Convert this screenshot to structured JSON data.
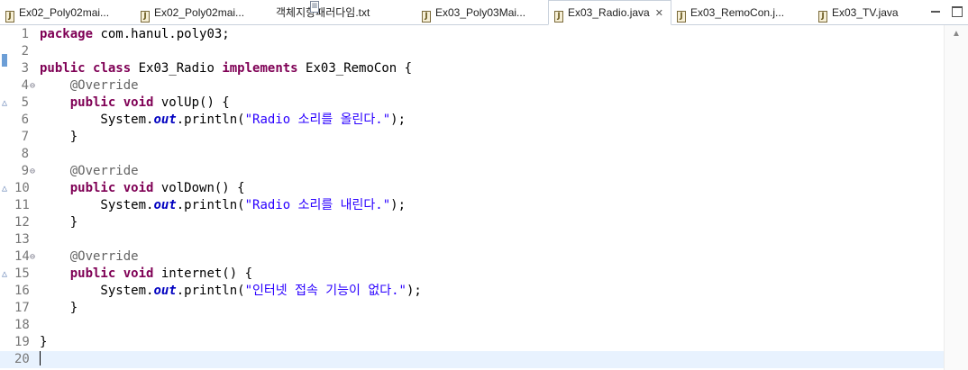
{
  "tabs": [
    {
      "label": "Ex02_Poly02mai...",
      "icon": "java-file-icon",
      "active": false
    },
    {
      "label": "Ex02_Poly02mai...",
      "icon": "java-file-icon",
      "active": false
    },
    {
      "label": "객체지향패러다임.txt",
      "icon": "text-file-icon",
      "active": false
    },
    {
      "label": "Ex03_Poly03Mai...",
      "icon": "java-file-icon",
      "active": false
    },
    {
      "label": "Ex03_Radio.java",
      "icon": "java-file-icon",
      "active": true
    },
    {
      "label": "Ex03_RemoCon.j...",
      "icon": "java-file-icon",
      "active": false
    },
    {
      "label": "Ex03_TV.java",
      "icon": "java-file-icon",
      "active": false
    }
  ],
  "editor": {
    "current_line": 20,
    "lines": [
      {
        "n": "1",
        "code": [
          [
            "kw",
            "package"
          ],
          [
            "t",
            " com.hanul.poly03;"
          ]
        ]
      },
      {
        "n": "2",
        "code": []
      },
      {
        "n": "3",
        "code": [
          [
            "kw",
            "public"
          ],
          [
            "t",
            " "
          ],
          [
            "kw",
            "class"
          ],
          [
            "t",
            " Ex03_Radio "
          ],
          [
            "kw",
            "implements"
          ],
          [
            "t",
            " Ex03_RemoCon {"
          ]
        ]
      },
      {
        "n": "4",
        "fold": true,
        "code": [
          [
            "t",
            "    "
          ],
          [
            "ann",
            "@Override"
          ]
        ]
      },
      {
        "n": "5",
        "override": true,
        "code": [
          [
            "t",
            "    "
          ],
          [
            "kw",
            "public"
          ],
          [
            "t",
            " "
          ],
          [
            "kw",
            "void"
          ],
          [
            "t",
            " volUp() {"
          ]
        ]
      },
      {
        "n": "6",
        "code": [
          [
            "t",
            "        System."
          ],
          [
            "fld",
            "out"
          ],
          [
            "t",
            ".println("
          ],
          [
            "str",
            "\"Radio 소리를 올린다.\""
          ],
          [
            "t",
            ");"
          ]
        ]
      },
      {
        "n": "7",
        "code": [
          [
            "t",
            "    }"
          ]
        ]
      },
      {
        "n": "8",
        "code": []
      },
      {
        "n": "9",
        "fold": true,
        "code": [
          [
            "t",
            "    "
          ],
          [
            "ann",
            "@Override"
          ]
        ]
      },
      {
        "n": "10",
        "override": true,
        "code": [
          [
            "t",
            "    "
          ],
          [
            "kw",
            "public"
          ],
          [
            "t",
            " "
          ],
          [
            "kw",
            "void"
          ],
          [
            "t",
            " volDown() {"
          ]
        ]
      },
      {
        "n": "11",
        "code": [
          [
            "t",
            "        System."
          ],
          [
            "fld",
            "out"
          ],
          [
            "t",
            ".println("
          ],
          [
            "str",
            "\"Radio 소리를 내린다.\""
          ],
          [
            "t",
            ");"
          ]
        ]
      },
      {
        "n": "12",
        "code": [
          [
            "t",
            "    }"
          ]
        ]
      },
      {
        "n": "13",
        "code": []
      },
      {
        "n": "14",
        "fold": true,
        "code": [
          [
            "t",
            "    "
          ],
          [
            "ann",
            "@Override"
          ]
        ]
      },
      {
        "n": "15",
        "override": true,
        "code": [
          [
            "t",
            "    "
          ],
          [
            "kw",
            "public"
          ],
          [
            "t",
            " "
          ],
          [
            "kw",
            "void"
          ],
          [
            "t",
            " internet() {"
          ]
        ]
      },
      {
        "n": "16",
        "code": [
          [
            "t",
            "        System."
          ],
          [
            "fld",
            "out"
          ],
          [
            "t",
            ".println("
          ],
          [
            "str",
            "\"인터넷 접속 기능이 없다.\""
          ],
          [
            "t",
            ");"
          ]
        ]
      },
      {
        "n": "17",
        "code": [
          [
            "t",
            "    }"
          ]
        ]
      },
      {
        "n": "18",
        "code": []
      },
      {
        "n": "19",
        "code": [
          [
            "t",
            "}"
          ]
        ]
      },
      {
        "n": "20",
        "code": []
      }
    ]
  },
  "colors": {
    "keyword": "#7f0055",
    "annotation": "#646464",
    "string": "#2a00ff",
    "static_field": "#0000c0",
    "current_line_bg": "#e8f2fe"
  }
}
